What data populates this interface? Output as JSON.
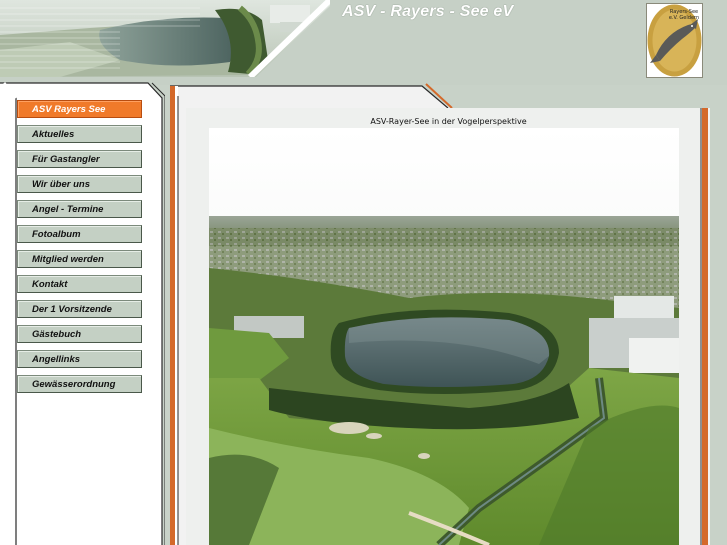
{
  "header": {
    "title": "ASV - Rayers - See eV",
    "logo": {
      "line1": "Rayers-See",
      "line2": "e.V. Geldern",
      "ring_text": "Angelsportverein"
    }
  },
  "nav": {
    "items": [
      {
        "label": "ASV Rayers See",
        "active": true
      },
      {
        "label": "Aktuelles"
      },
      {
        "label": "Für Gastangler"
      },
      {
        "label": "Wir über uns"
      },
      {
        "label": "Angel - Termine"
      },
      {
        "label": "Fotoalbum"
      },
      {
        "label": "Mitglied werden"
      },
      {
        "label": "Kontakt"
      },
      {
        "label": "Der 1 Vorsitzende"
      },
      {
        "label": "Gästebuch"
      },
      {
        "label": "Angellinks"
      },
      {
        "label": "Gewässerordnung"
      }
    ]
  },
  "content": {
    "caption": "ASV-Rayer-See in der Vogelperspektive"
  },
  "colors": {
    "background": "#c8d2c8",
    "nav_button": "#c4d0c4",
    "nav_active": "#f07a2a",
    "accent_orange": "#d4692a",
    "panel_white": "#ffffff",
    "logo_gold": "#c8a040"
  }
}
